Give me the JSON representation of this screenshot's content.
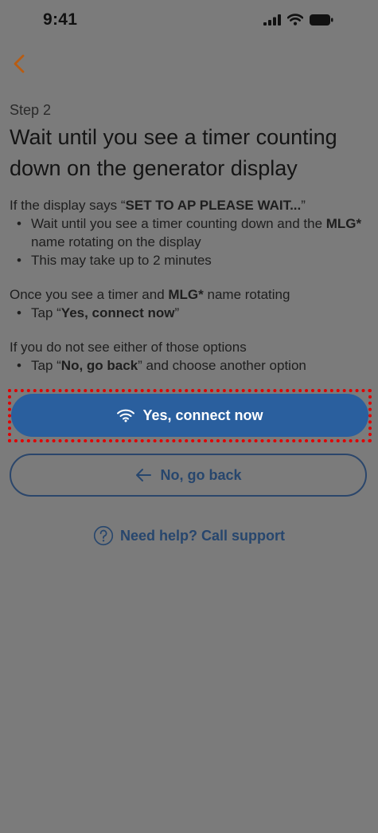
{
  "status_bar": {
    "time": "9:41"
  },
  "header": {
    "back_icon": "chevron-left-icon",
    "step": "Step 2",
    "title": "Wait until you see a timer counting down on the generator display"
  },
  "instructions": {
    "section1": {
      "intro_prefix": "If the display says “",
      "intro_bold": "SET TO AP PLEASE WAIT...",
      "intro_suffix": "”",
      "bullet1_prefix": "Wait until you see a timer counting down and the ",
      "bullet1_bold": "MLG*",
      "bullet1_suffix": " name rotating on the display",
      "bullet2": "This may take up to 2 minutes"
    },
    "section2": {
      "intro_prefix": "Once you see a timer and ",
      "intro_bold": "MLG*",
      "intro_suffix": " name rotating",
      "bullet1_prefix": "Tap “",
      "bullet1_bold": "Yes, connect now",
      "bullet1_suffix": "”"
    },
    "section3": {
      "intro": "If you do not see either of those options",
      "bullet1_prefix": "Tap “",
      "bullet1_bold": "No, go back",
      "bullet1_suffix": "” and choose another option"
    }
  },
  "actions": {
    "primary_label": "Yes, connect now",
    "primary_icon": "wifi-icon",
    "secondary_label": "No, go back",
    "secondary_icon": "arrow-left-icon",
    "help_label": "Need help? Call support",
    "help_icon": "question-circle-icon"
  },
  "colors": {
    "overlay_background": "#7b7b7b",
    "primary_button": "#2a5f9e",
    "secondary_border": "#2b466b",
    "back_chevron": "#b85c12",
    "highlight": "#e00000"
  }
}
